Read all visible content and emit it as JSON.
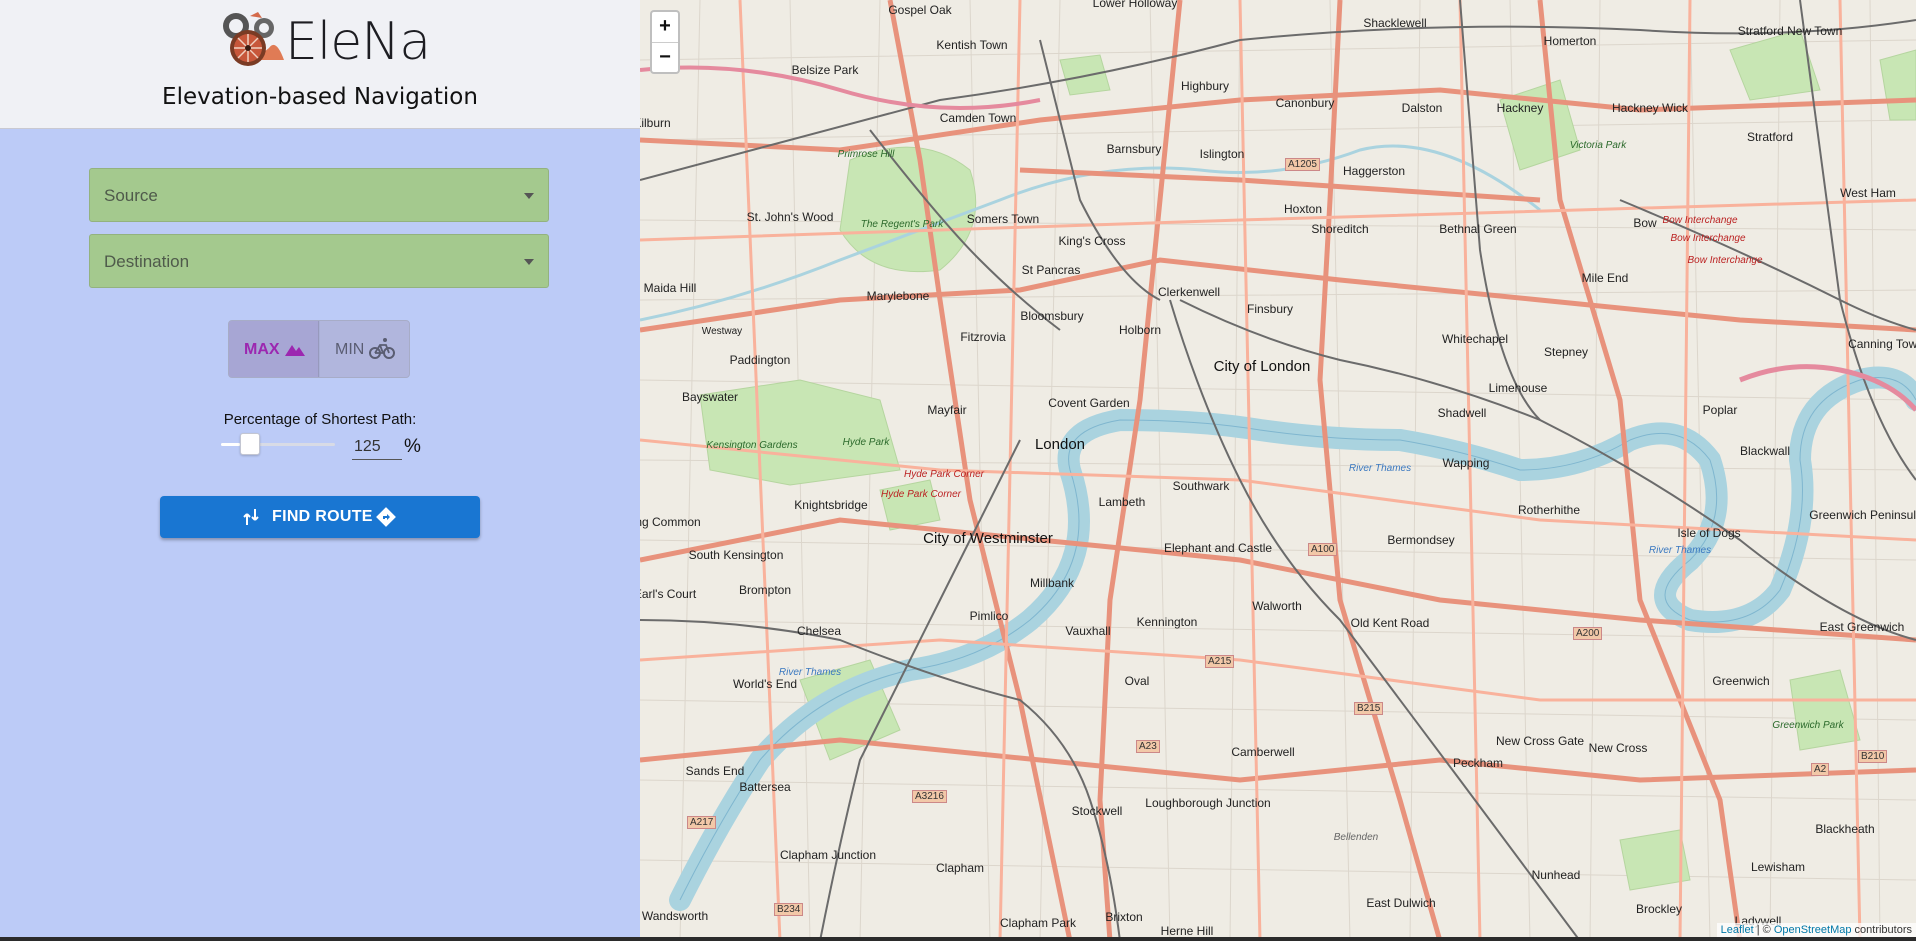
{
  "header": {
    "brand": "EleNa",
    "subtitle": "Elevation-based Navigation"
  },
  "form": {
    "source_placeholder": "Source",
    "destination_placeholder": "Destination",
    "toggle": {
      "max_label": "MAX",
      "min_label": "MIN",
      "selected": "MAX"
    },
    "percentage_label": "Percentage of Shortest Path:",
    "percentage_value": "125",
    "percentage_unit": "%",
    "slider_fraction": 0.2,
    "find_route_label": "FIND ROUTE"
  },
  "colors": {
    "panel_bg": "#bccbf7",
    "select_bg": "#a4c98e",
    "max_accent": "#9c27b0",
    "button_blue": "#1976d2"
  },
  "icons": {
    "logo": "bicycle-gears-logo",
    "max": "mountain-icon",
    "min": "bicycle-icon",
    "route_left": "fork-route-icon",
    "route_right": "directions-icon"
  },
  "map": {
    "zoom_in": "+",
    "zoom_out": "−",
    "attribution": {
      "leaflet": "Leaflet",
      "sep": " | © ",
      "osm": "OpenStreetMap",
      "suffix": " contributors"
    },
    "places": [
      "Gospel Oak",
      "Lower Holloway",
      "Shacklewell",
      "Stratford New Town",
      "Kentish Town",
      "Homerton",
      "Belsize Park",
      "Highbury",
      "Canonbury",
      "Dalston",
      "Hackney",
      "Hackney Wick",
      "Stratford",
      "Camden Town",
      "Islington",
      "Barnsbury",
      "Haggerston",
      "Primrose Hill",
      "Somers Town",
      "King's Cross",
      "Hoxton",
      "Bethnal Green",
      "Bow",
      "West Ham",
      "St. John's Wood",
      "The Regent's Park",
      "St Pancras",
      "Clerkenwell",
      "Shoreditch",
      "Mile End",
      "Maida Hill",
      "Marylebone",
      "Bloomsbury",
      "Finsbury",
      "Whitechapel",
      "Stepney",
      "Canning Town",
      "Fitzrovia",
      "Holborn",
      "Paddington",
      "City of London",
      "Limehouse",
      "Poplar",
      "Bayswater",
      "Mayfair",
      "Covent Garden",
      "Shadwell",
      "London",
      "Blackwall",
      "Kensington Gardens",
      "Hyde Park",
      "Wapping",
      "Southwark",
      "Knightsbridge",
      "Lambeth",
      "Rotherhithe",
      "Greenwich Peninsula",
      "City of Westminster",
      "Bermondsey",
      "Isle of Dogs",
      "South Kensington",
      "Elephant and Castle",
      "Brompton",
      "Millbank",
      "Walworth",
      "Old Kent Road",
      "Chelsea",
      "Pimlico",
      "Vauxhall",
      "Kennington",
      "East Greenwich",
      "World's End",
      "Oval",
      "Greenwich",
      "Sands End",
      "New Cross Gate",
      "New Cross",
      "Battersea",
      "Camberwell",
      "Peckham",
      "Stockwell",
      "Loughborough Junction",
      "Blackheath",
      "Clapham Junction",
      "Clapham",
      "Nunhead",
      "Lewisham",
      "Brixton",
      "Clapham Park",
      "East Dulwich",
      "Herne Hill",
      "Brockley",
      "Ladywell",
      "Wandsworth",
      "Earl's Court",
      "Kilburn",
      "Ealing Common"
    ],
    "landmark_labels": [
      "Hyde Park Corner",
      "Bow Interchange",
      "River Thames",
      "Victoria Park",
      "Greenwich Park",
      "Bellenden",
      "Westway"
    ],
    "road_shields": [
      "A1205",
      "A100",
      "A215",
      "A200",
      "B215",
      "A23",
      "A3216",
      "A217",
      "B234",
      "A2",
      "B210"
    ]
  }
}
